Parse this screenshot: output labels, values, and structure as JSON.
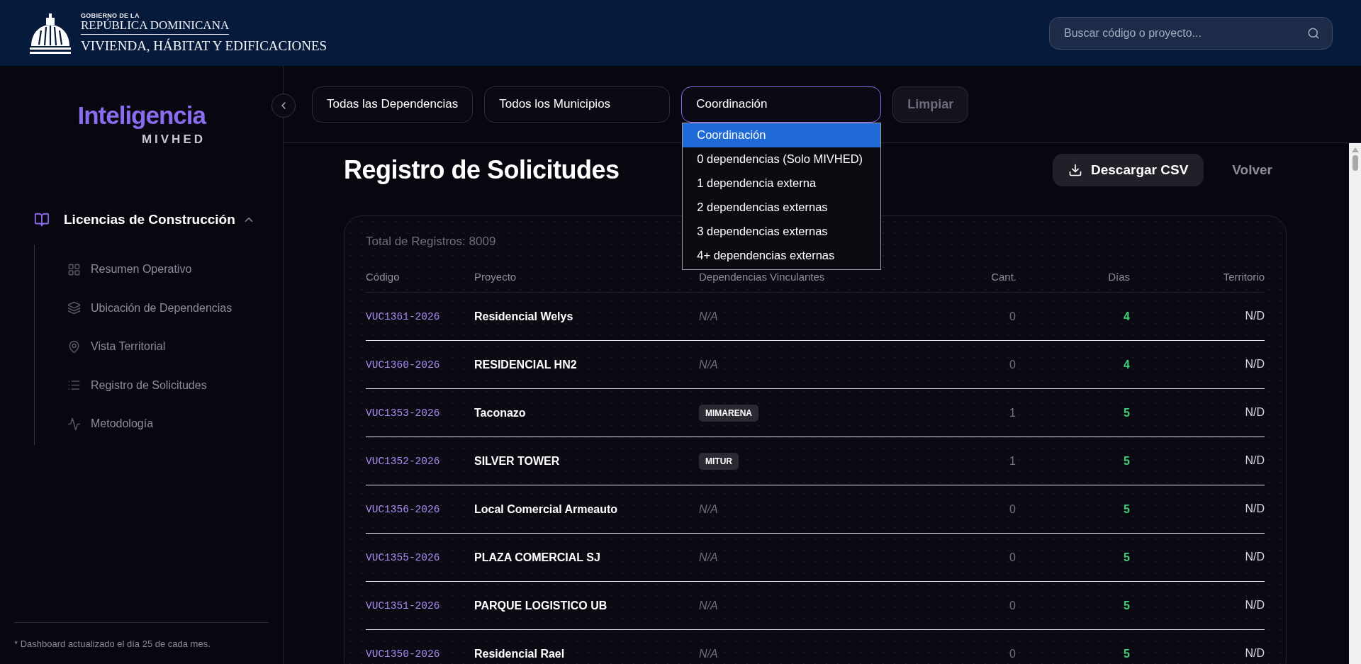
{
  "header": {
    "logo": {
      "line_1": "GOBIERNO DE LA",
      "line_2": "REPÚBLICA DOMINICANA",
      "line_3": "VIVIENDA, HÁBITAT Y EDIFICACIONES"
    },
    "search": {
      "placeholder": "Buscar código o proyecto..."
    }
  },
  "sidebar": {
    "brand": "Inteligencia",
    "brand_sub": "MIVHED",
    "section": {
      "label": "Licencias de Construcción",
      "expanded": true,
      "items": [
        {
          "label": "Resumen Operativo"
        },
        {
          "label": "Ubicación de Dependencias"
        },
        {
          "label": "Vista Territorial"
        },
        {
          "label": "Registro de Solicitudes"
        },
        {
          "label": "Metodología"
        }
      ]
    },
    "footnote": "* Dashboard actualizado el día 25 de cada mes."
  },
  "filters": [
    {
      "value": "Todas las Dependencias",
      "open": false
    },
    {
      "value": "Todos los Municipios",
      "open": false
    },
    {
      "value": "Coordinación",
      "open": true,
      "options": [
        {
          "label": "Coordinación",
          "selected": true
        },
        {
          "label": "0 dependencias (Solo MIVHED)",
          "selected": false
        },
        {
          "label": "1 dependencia externa",
          "selected": false
        },
        {
          "label": "2 dependencias externas",
          "selected": false
        },
        {
          "label": "3 dependencias externas",
          "selected": false
        },
        {
          "label": "4+ dependencias externas",
          "selected": false
        }
      ]
    }
  ],
  "clear_button": "Limpiar",
  "page": {
    "title": "Registro de Solicitudes",
    "download_button": "Descargar CSV",
    "back_link": "Volver"
  },
  "table": {
    "total": "Total de Registros: 8009",
    "columns": [
      "Código",
      "Proyecto",
      "Dependencias Vinculantes",
      "Cant.",
      "Días",
      "Territorio"
    ],
    "rows": [
      {
        "code": "VUC1361-2026",
        "project": "Residencial Welys",
        "dependencies": {
          "kind": "none",
          "text": "N/A"
        },
        "count": "0",
        "days": "4",
        "territory": "N/D"
      },
      {
        "code": "VUC1360-2026",
        "project": "RESIDENCIAL HN2",
        "dependencies": {
          "kind": "none",
          "text": "N/A"
        },
        "count": "0",
        "days": "4",
        "territory": "N/D"
      },
      {
        "code": "VUC1353-2026",
        "project": "Taconazo",
        "dependencies": {
          "kind": "tag",
          "text": "MIMARENA"
        },
        "count": "1",
        "days": "5",
        "territory": "N/D"
      },
      {
        "code": "VUC1352-2026",
        "project": "SILVER TOWER",
        "dependencies": {
          "kind": "tag",
          "text": "MITUR"
        },
        "count": "1",
        "days": "5",
        "territory": "N/D"
      },
      {
        "code": "VUC1356-2026",
        "project": "Local Comercial Armeauto",
        "dependencies": {
          "kind": "none",
          "text": "N/A"
        },
        "count": "0",
        "days": "5",
        "territory": "N/D"
      },
      {
        "code": "VUC1355-2026",
        "project": "PLAZA COMERCIAL SJ",
        "dependencies": {
          "kind": "none",
          "text": "N/A"
        },
        "count": "0",
        "days": "5",
        "territory": "N/D"
      },
      {
        "code": "VUC1351-2026",
        "project": "PARQUE LOGISTICO UB",
        "dependencies": {
          "kind": "none",
          "text": "N/A"
        },
        "count": "0",
        "days": "5",
        "territory": "N/D"
      },
      {
        "code": "VUC1350-2026",
        "project": "Residencial Rael",
        "dependencies": {
          "kind": "none",
          "text": "N/A"
        },
        "count": "0",
        "days": "5",
        "territory": "N/D"
      }
    ]
  }
}
